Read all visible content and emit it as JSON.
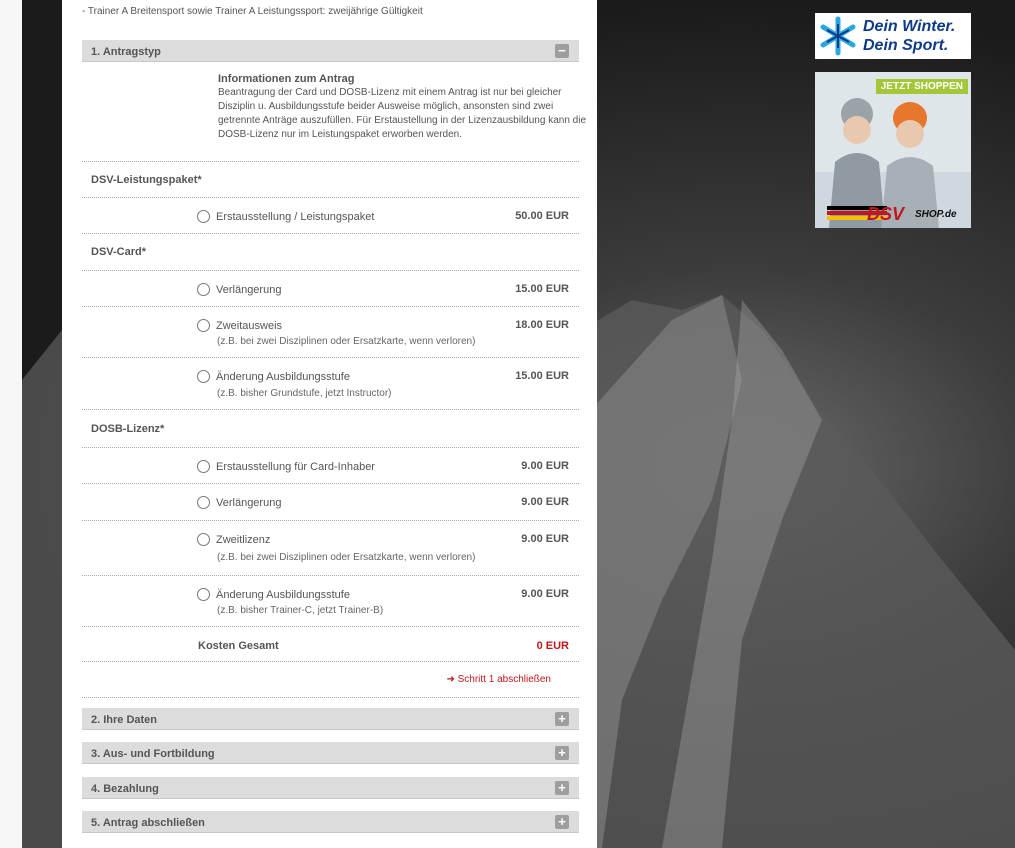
{
  "note": "- Trainer A Breitensport sowie Trainer A Leistungssport: zweijährige Gültigkeit",
  "sections": [
    {
      "title": "1. Antragstyp",
      "toggle": "−"
    },
    {
      "title": "2. Ihre Daten",
      "toggle": "+"
    },
    {
      "title": "3. Aus- und Fortbildung",
      "toggle": "+"
    },
    {
      "title": "4. Bezahlung",
      "toggle": "+"
    },
    {
      "title": "5. Antrag abschließen",
      "toggle": "+"
    }
  ],
  "info": {
    "title": "Informationen zum Antrag",
    "text": "Beantragung der Card und DOSB-Lizenz mit einem Antrag ist nur bei gleicher Disziplin u. Ausbildungsstufe beider Ausweise möglich, ansonsten sind zwei getrennte Anträge auszufüllen. Für Erstaustellung in der Lizenzausbildung kann die DOSB-Lizenz nur im Leistungspaket erworben werden."
  },
  "groups": {
    "leistungspaket": "DSV-Leistungspaket*",
    "card": "DSV-Card*",
    "lizenz": "DOSB-Lizenz*"
  },
  "options": {
    "lp1": {
      "label": "Erstausstellung / Leistungspaket",
      "price": "50.00 EUR"
    },
    "c1": {
      "label": "Verlängerung",
      "price": "15.00 EUR"
    },
    "c2": {
      "label": "Zweitausweis",
      "sub": "(z.B. bei zwei Disziplinen oder Ersatzkarte, wenn verloren)",
      "price": "18.00 EUR"
    },
    "c3": {
      "label": "Änderung Ausbildungsstufe",
      "sub": "(z.B. bisher Grundstufe, jetzt Instructor)",
      "price": "15.00 EUR"
    },
    "l1": {
      "label": "Erstausstellung für Card-Inhaber",
      "price": "9.00 EUR"
    },
    "l2": {
      "label": "Verlängerung",
      "price": "9.00 EUR"
    },
    "l3": {
      "label": "Zweitlizenz",
      "sub": "(z.B. bei zwei Disziplinen oder Ersatzkarte, wenn verloren)",
      "price": "9.00 EUR"
    },
    "l4": {
      "label": "Änderung Ausbildungsstufe",
      "sub": "(z.B. bisher Trainer-C, jetzt Trainer-B)",
      "price": "9.00 EUR"
    }
  },
  "total": {
    "label": "Kosten Gesamt",
    "value": "0 EUR"
  },
  "step_link": {
    "arrow": "➜",
    "label": "Schritt 1 abschließen"
  },
  "ads": {
    "winter_line1": "Dein Winter.",
    "winter_line2": "Dein Sport.",
    "shop_button": "JETZT SHOPPEN",
    "shop_brand": "DSV",
    "shop_domain": "SHOP.de"
  },
  "colors": {
    "accent_red": "#c0171c",
    "section_bg": "#dcdcdc",
    "ad_blue": "#0e3a8a",
    "shop_green": "#a4c639"
  }
}
